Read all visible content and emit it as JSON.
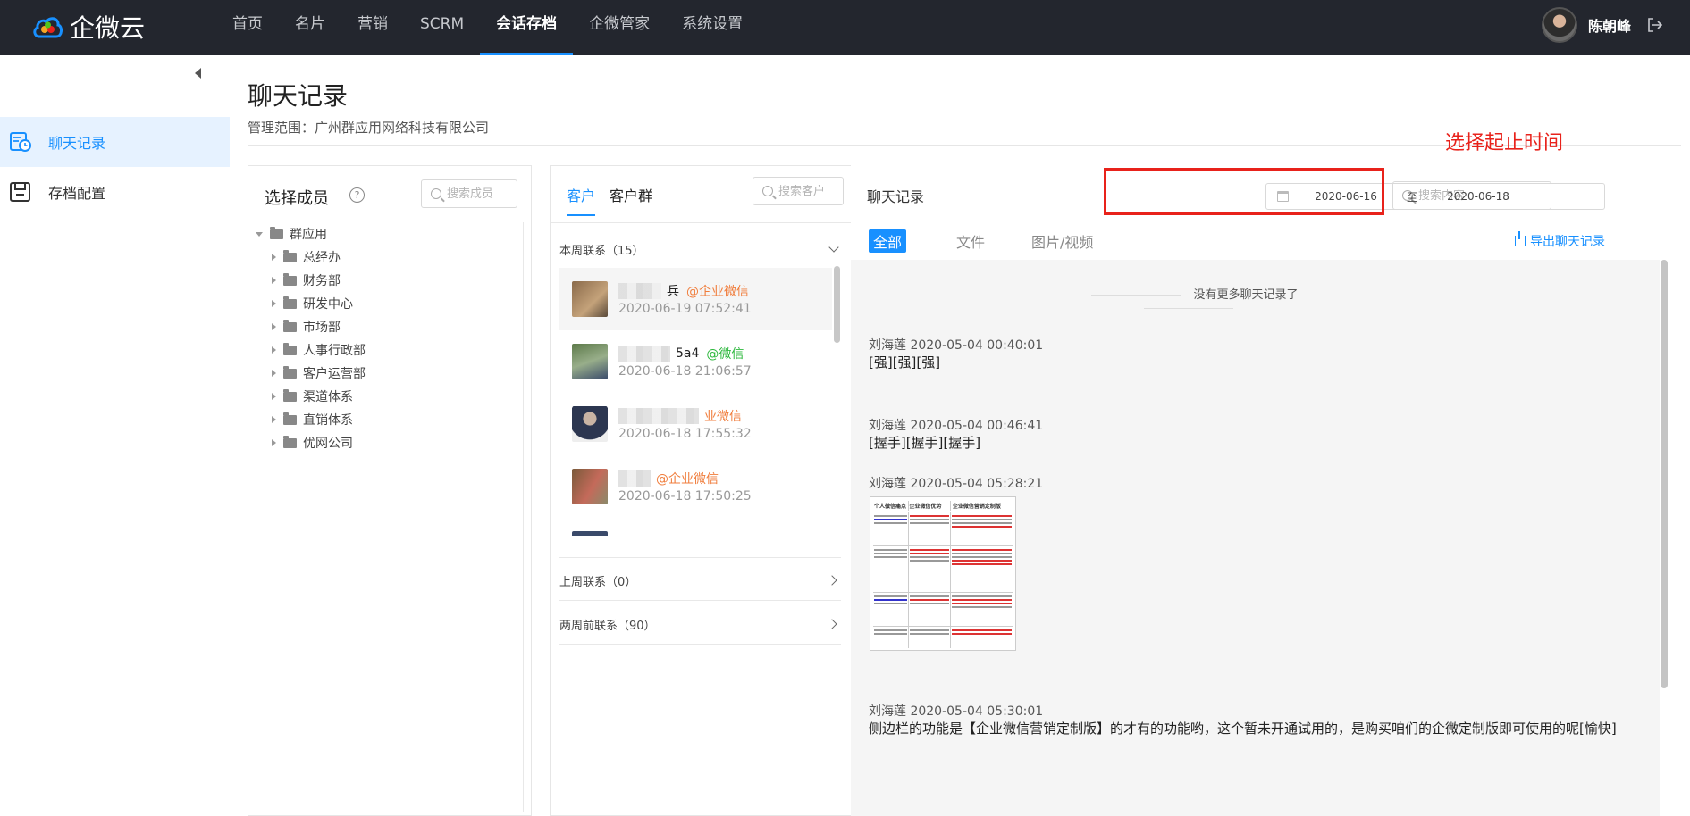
{
  "topbar": {
    "logo_text": "企微云",
    "nav": [
      "首页",
      "名片",
      "营销",
      "SCRM",
      "会话存档",
      "企微管家",
      "系统设置"
    ],
    "active_nav": "会话存档",
    "user_name": "陈朝峰"
  },
  "sidebar": {
    "items": [
      {
        "label": "聊天记录",
        "icon": "chat-record-icon",
        "active": true
      },
      {
        "label": "存档配置",
        "icon": "archive-config-icon",
        "active": false
      }
    ]
  },
  "page": {
    "title": "聊天记录",
    "scope": "管理范围：广州群应用网络科技有限公司",
    "hint": "选择起止时间"
  },
  "members": {
    "title": "选择成员",
    "search_placeholder": "搜索成员",
    "root": "群应用",
    "departments": [
      "总经办",
      "财务部",
      "研发中心",
      "市场部",
      "人事行政部",
      "客户运营部",
      "渠道体系",
      "直销体系",
      "优网公司"
    ]
  },
  "customers": {
    "tabs": [
      "客户",
      "客户群"
    ],
    "search_placeholder": "搜索客户",
    "groups": [
      {
        "label": "本周联系（15）",
        "expanded": true
      },
      {
        "label": "上周联系（0）",
        "expanded": false
      },
      {
        "label": "两周前联系（90）",
        "expanded": false
      }
    ],
    "contacts": [
      {
        "name": "兵",
        "tag": "@企业微信",
        "tag_type": "org",
        "time": "2020-06-19 07:52:41",
        "colors": [
          "#8a6a4a",
          "#c4a27a"
        ]
      },
      {
        "name": "5a4",
        "tag": "@微信",
        "tag_type": "wx",
        "time": "2020-06-18 21:06:57",
        "colors": [
          "#5d7a4a",
          "#98ae8a"
        ]
      },
      {
        "name": "",
        "tag": "业微信",
        "tag_type": "org",
        "time": "2020-06-18 17:55:32",
        "colors": [
          "#2c3650",
          "#c9b4a4"
        ]
      },
      {
        "name": "",
        "tag": "@企业微信",
        "tag_type": "org",
        "time": "2020-06-18 17:50:25",
        "colors": [
          "#7a5a3a",
          "#c46a5a"
        ]
      }
    ]
  },
  "chat": {
    "title": "聊天记录",
    "search_placeholder": "搜索内容",
    "date_start": "2020-06-16",
    "date_sep": "至",
    "date_end": "2020-06-18",
    "tabs": [
      "全部",
      "文件",
      "图片/视频"
    ],
    "export_label": "导出聊天记录",
    "no_more": "没有更多聊天记录了",
    "messages": [
      {
        "meta": "刘海莲 2020-05-04 00:40:01",
        "text": "[强][强][强]"
      },
      {
        "meta": "刘海莲 2020-05-04 00:46:41",
        "text": "[握手][握手][握手]"
      },
      {
        "meta": "刘海莲 2020-05-04 05:28:21",
        "text": ""
      },
      {
        "meta": "刘海莲 2020-05-04 05:30:01",
        "text": "侧边栏的功能是【企业微信营销定制版】的才有的功能哟，这个暂未开通试用的，是购买咱们的企微定制版即可使用的呢[愉快]"
      }
    ],
    "image_headers": [
      "个人微信痛点",
      "企业微信优势",
      "企业微信营销定制版"
    ]
  },
  "colors": {
    "accent": "#1890ff",
    "topbar_bg": "#23262e",
    "hint_red": "#e8221b",
    "org_tag": "#f07d3c",
    "wx_tag": "#2db83d"
  }
}
